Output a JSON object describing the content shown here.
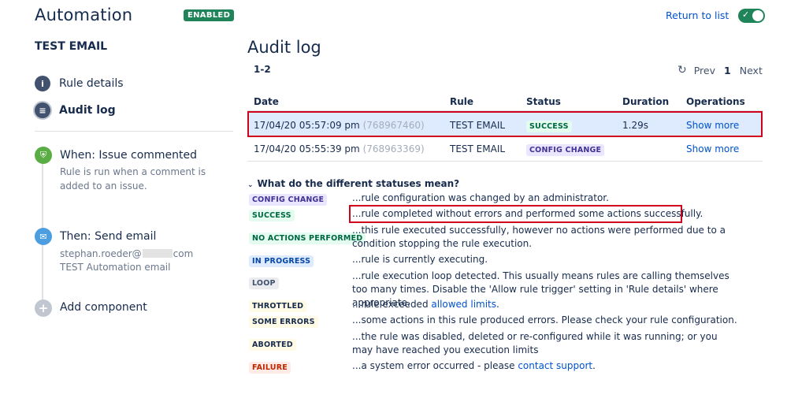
{
  "header": {
    "title": "Automation",
    "status_badge": "ENABLED",
    "return_link": "Return to list"
  },
  "sidebar": {
    "rule_name": "TEST EMAIL",
    "nav": [
      {
        "label": "Rule details",
        "icon": "info-icon"
      },
      {
        "label": "Audit log",
        "icon": "list-icon"
      }
    ],
    "trigger": {
      "title": "When: Issue commented",
      "description": "Rule is run when a comment is added to an issue."
    },
    "action": {
      "title": "Then: Send email",
      "recipient_prefix": "stephan.roeder@",
      "recipient_suffix": "com",
      "subject": "TEST Automation email"
    },
    "add_component": "Add component"
  },
  "main": {
    "title": "Audit log",
    "range": "1-2",
    "pager": {
      "prev": "Prev",
      "page": "1",
      "next": "Next"
    },
    "columns": [
      "Date",
      "Rule",
      "Status",
      "Duration",
      "Operations"
    ],
    "rows": [
      {
        "date": "17/04/20 05:57:09 pm",
        "exec_id": "(768967460)",
        "rule": "TEST EMAIL",
        "status": "SUCCESS",
        "duration": "1.29s",
        "operation": "Show more"
      },
      {
        "date": "17/04/20 05:55:39 pm",
        "exec_id": "(768963369)",
        "rule": "TEST EMAIL",
        "status": "CONFIG CHANGE",
        "duration": "",
        "operation": "Show more"
      }
    ],
    "legend": {
      "heading": "What do the different statuses mean?",
      "items": [
        {
          "status": "CONFIG CHANGE",
          "text": "...rule configuration was changed by an administrator."
        },
        {
          "status": "SUCCESS",
          "text": "...rule completed without errors and performed some actions successfully."
        },
        {
          "status": "NO ACTIONS PERFORMED",
          "text": "...this rule executed successfully, however no actions were performed due to a condition stopping the rule execution."
        },
        {
          "status": "IN PROGRESS",
          "text": "...rule is currently executing."
        },
        {
          "status": "LOOP",
          "text": "...rule execution loop detected. This usually means rules are calling themselves too many times. Disable the 'Allow rule trigger' setting in 'Rule details' where appropriate."
        },
        {
          "status": "THROTTLED",
          "text": "...rule exceeded ",
          "link": "allowed limits",
          "after": "."
        },
        {
          "status": "SOME ERRORS",
          "text": "...some actions in this rule produced errors. Please check your rule configuration."
        },
        {
          "status": "ABORTED",
          "text": "...the rule was disabled, deleted or re-configured while it was running; or you may have reached you execution limits"
        },
        {
          "status": "FAILURE",
          "text": "...a system error occurred - please ",
          "link": "contact support",
          "after": "."
        }
      ]
    }
  },
  "colors": {
    "accent": "#0052cc",
    "enabled": "#1f845a",
    "highlight_border": "#d0021b",
    "selected_row": "#deebff"
  }
}
